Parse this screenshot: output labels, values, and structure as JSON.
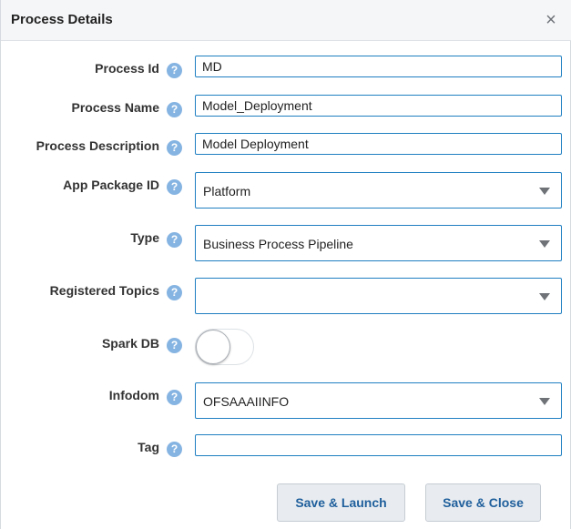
{
  "dialog": {
    "title": "Process Details",
    "close_icon": "×"
  },
  "help_glyph": "?",
  "fields": {
    "process_id": {
      "label": "Process Id",
      "value": "MD"
    },
    "process_name": {
      "label": "Process Name",
      "value": "Model_Deployment"
    },
    "process_description": {
      "label": "Process Description",
      "value": "Model Deployment"
    },
    "app_package_id": {
      "label": "App Package ID",
      "value": "Platform"
    },
    "type": {
      "label": "Type",
      "value": "Business Process Pipeline"
    },
    "registered_topics": {
      "label": "Registered Topics",
      "value": ""
    },
    "spark_db": {
      "label": "Spark DB",
      "on": false
    },
    "infodom": {
      "label": "Infodom",
      "value": "OFSAAAIINFO"
    },
    "tag": {
      "label": "Tag",
      "value": ""
    }
  },
  "buttons": {
    "save_launch": "Save & Launch",
    "save_close": "Save & Close"
  },
  "colors": {
    "accent_border": "#1f7fc1",
    "help_icon": "#86b4e2",
    "button_text": "#1f5f9c"
  }
}
